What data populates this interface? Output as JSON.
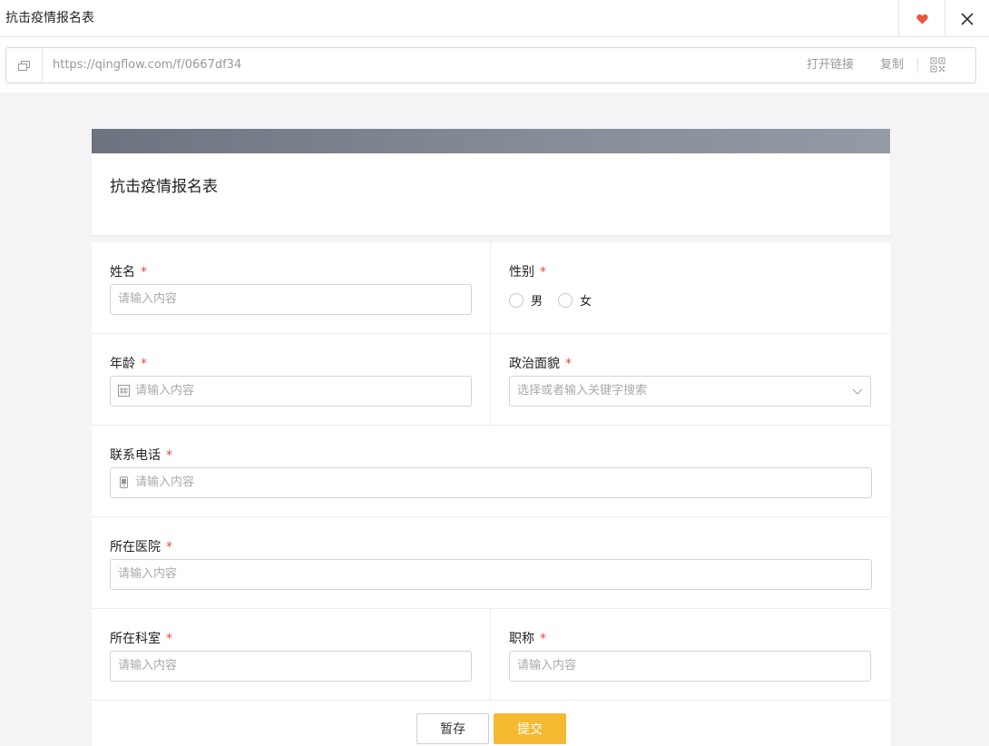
{
  "window": {
    "title": "抗击疫情报名表",
    "icons": {
      "favorite": "heart-icon",
      "close": "close-icon"
    },
    "colors": {
      "heart": "#e8563f"
    }
  },
  "link_bar": {
    "url": "https://qingflow.com/f/0667df34",
    "open_label": "打开链接",
    "copy_label": "复制",
    "icons": {
      "link": "copy-link-icon",
      "qr": "qr-code-icon"
    }
  },
  "form": {
    "title": "抗击疫情报名表",
    "required_mark": "*",
    "fields": {
      "name": {
        "label": "姓名",
        "placeholder": "请输入内容"
      },
      "gender": {
        "label": "性别",
        "options": [
          "男",
          "女"
        ]
      },
      "age": {
        "label": "年龄",
        "placeholder": "请输入内容",
        "icon": "number-icon"
      },
      "political": {
        "label": "政治面貌",
        "placeholder": "选择或者输入关键字搜索",
        "icon": "chevron-down-icon"
      },
      "phone": {
        "label": "联系电话",
        "placeholder": "请输入内容",
        "icon": "phone-icon"
      },
      "hospital": {
        "label": "所在医院",
        "placeholder": "请输入内容"
      },
      "department": {
        "label": "所在科室",
        "placeholder": "请输入内容"
      },
      "job_title": {
        "label": "职称",
        "placeholder": "请输入内容"
      }
    },
    "buttons": {
      "save": "暂存",
      "submit": "提交"
    },
    "colors": {
      "submit": "#f5b932",
      "required": "#e64a3b",
      "banner": "#7b818d"
    }
  }
}
